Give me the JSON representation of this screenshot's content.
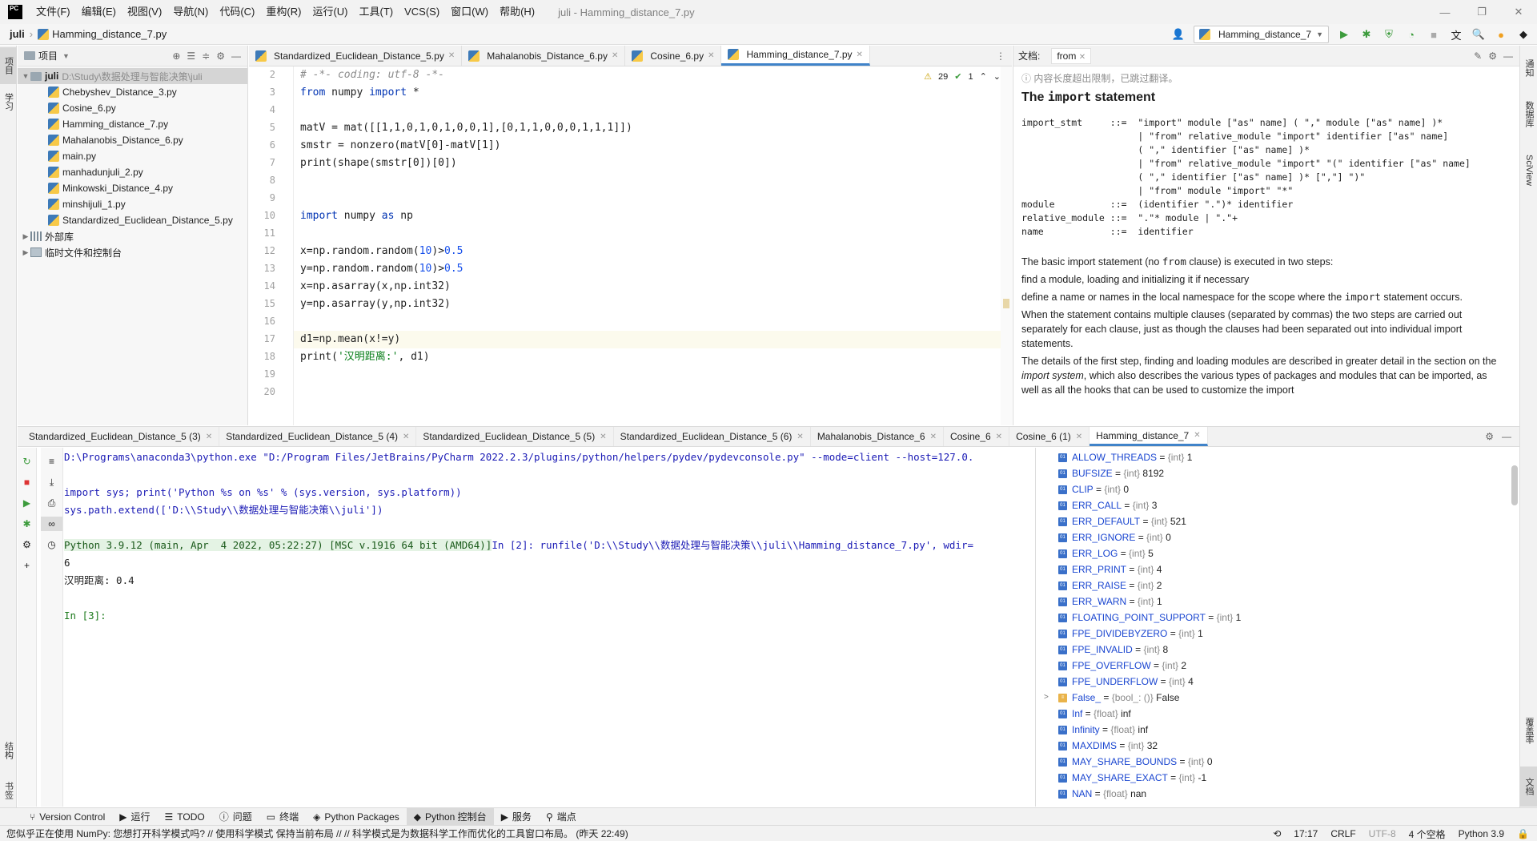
{
  "app": {
    "logo_text": "PC",
    "window_title": "juli - Hamming_distance_7.py",
    "menu": [
      "文件(F)",
      "编辑(E)",
      "视图(V)",
      "导航(N)",
      "代码(C)",
      "重构(R)",
      "运行(U)",
      "工具(T)",
      "VCS(S)",
      "窗口(W)",
      "帮助(H)"
    ]
  },
  "navbar": {
    "project": "juli",
    "file": "Hamming_distance_7.py",
    "run_config": "Hamming_distance_7"
  },
  "left_strip": {
    "project_tab": "项目",
    "learn_tab": "学习",
    "structure_tab": "结构",
    "bookmarks_tab": "书签"
  },
  "right_strip": {
    "notifications_tab": "通知",
    "database_tab": "数据库",
    "sciview_tab": "SciView",
    "coverage_tab": "覆盖率",
    "doc_tab": "文档"
  },
  "project_panel": {
    "title": "项目",
    "root_name": "juli",
    "root_path": "D:\\Study\\数据处理与智能决策\\juli",
    "files": [
      "Chebyshev_Distance_3.py",
      "Cosine_6.py",
      "Hamming_distance_7.py",
      "Mahalanobis_Distance_6.py",
      "main.py",
      "manhadunjuli_2.py",
      "Minkowski_Distance_4.py",
      "minshijuli_1.py",
      "Standardized_Euclidean_Distance_5.py"
    ],
    "external_libs": "外部库",
    "scratches": "临时文件和控制台"
  },
  "editor": {
    "tabs": [
      "Standardized_Euclidean_Distance_5.py",
      "Mahalanobis_Distance_6.py",
      "Cosine_6.py",
      "Hamming_distance_7.py"
    ],
    "active_tab": "Hamming_distance_7.py",
    "warnings": "29",
    "weak_warnings": "1",
    "line_numbers": [
      "2",
      "3",
      "4",
      "5",
      "6",
      "7",
      "8",
      "9",
      "10",
      "11",
      "12",
      "13",
      "14",
      "15",
      "16",
      "17",
      "18",
      "19",
      "20"
    ],
    "lines": {
      "l2": "# -*- coding: utf-8 -*-",
      "l3_kw1": "from",
      "l3_mid": " numpy ",
      "l3_kw2": "import",
      "l3_end": " *",
      "l5": "matV = mat([[1,1,0,1,0,1,0,0,1],[0,1,1,0,0,0,1,1,1]])",
      "l6": "smstr = nonzero(matV[0]-matV[1])",
      "l7": "print(shape(smstr[0])[0])",
      "l10_kw1": "import",
      "l10_mid": " numpy ",
      "l10_kw2": "as",
      "l10_end": " np",
      "l12_a": "x=np.random.random(",
      "l12_n": "10",
      "l12_b": ")>",
      "l12_v": "0.5",
      "l13_a": "y=np.random.random(",
      "l13_n": "10",
      "l13_b": ")>",
      "l13_v": "0.5",
      "l14": "x=np.asarray(x,np.int32)",
      "l15": "y=np.asarray(y,np.int32)",
      "l17": "d1=np.mean(x!=y)",
      "l18_a": "print(",
      "l18_s": "'汉明距离:'",
      "l18_b": ", d1)"
    }
  },
  "doc_panel": {
    "header_label": "文档:",
    "tab": "from",
    "notice": "内容长度超出限制，已跳过翻译。",
    "title_pre": "The ",
    "title_code": "import",
    "title_post": " statement",
    "grammar": "import_stmt     ::=  \"import\" module [\"as\" name] ( \",\" module [\"as\" name] )*\n                     | \"from\" relative_module \"import\" identifier [\"as\" name]\n                     ( \",\" identifier [\"as\" name] )*\n                     | \"from\" relative_module \"import\" \"(\" identifier [\"as\" name]\n                     ( \",\" identifier [\"as\" name] )* [\",\"] \")\"\n                     | \"from\" module \"import\" \"*\"\nmodule          ::=  (identifier \".\")* identifier\nrelative_module ::=  \".\"* module | \".\"+\nname            ::=  identifier",
    "p1_pre": "The basic import statement (no ",
    "p1_code": "from",
    "p1_post": " clause) is executed in two steps:",
    "p2": "find a module, loading and initializing it if necessary",
    "p3_pre": "define a name or names in the local namespace for the scope where the ",
    "p3_code": "import",
    "p3_post": " statement occurs.",
    "p4": "When the statement contains multiple clauses (separated by commas) the two steps are carried out separately for each clause, just as though the clauses had been separated out into individual import statements.",
    "p5_pre": "The details of the first step, finding and loading modules are described in greater detail in the section on the ",
    "p5_em": "import system",
    "p5_post": ", which also describes the various types of packages and modules that can be imported, as well as all the hooks that can be used to customize the import"
  },
  "console_tabs": [
    "Standardized_Euclidean_Distance_5 (3)",
    "Standardized_Euclidean_Distance_5 (4)",
    "Standardized_Euclidean_Distance_5 (5)",
    "Standardized_Euclidean_Distance_5 (6)",
    "Mahalanobis_Distance_6",
    "Cosine_6",
    "Cosine_6 (1)",
    "Hamming_distance_7"
  ],
  "console": {
    "l1": "D:\\Programs\\anaconda3\\python.exe \"D:/Program Files/JetBrains/PyCharm 2022.2.3/plugins/python/helpers/pydev/pydevconsole.py\" --mode=client --host=127.0.",
    "l2": "import sys; print('Python %s on %s' % (sys.version, sys.platform))",
    "l3": "sys.path.extend(['D:\\\\Study\\\\数据处理与智能决策\\\\juli'])",
    "l4_banner": "Python 3.9.12 (main, Apr  4 2022, 05:22:27) [MSC v.1916 64 bit (AMD64)]",
    "l4_cmd": "In [2]: runfile('D:\\\\Study\\\\数据处理与智能决策\\\\juli\\\\Hamming_distance_7.py', wdir=",
    "l5": "6",
    "l6": "汉明距离: 0.4",
    "l7": "In [3]:"
  },
  "variables": [
    {
      "name": "ALLOW_THREADS",
      "type": "{int}",
      "value": "1"
    },
    {
      "name": "BUFSIZE",
      "type": "{int}",
      "value": "8192"
    },
    {
      "name": "CLIP",
      "type": "{int}",
      "value": "0"
    },
    {
      "name": "ERR_CALL",
      "type": "{int}",
      "value": "3"
    },
    {
      "name": "ERR_DEFAULT",
      "type": "{int}",
      "value": "521"
    },
    {
      "name": "ERR_IGNORE",
      "type": "{int}",
      "value": "0"
    },
    {
      "name": "ERR_LOG",
      "type": "{int}",
      "value": "5"
    },
    {
      "name": "ERR_PRINT",
      "type": "{int}",
      "value": "4"
    },
    {
      "name": "ERR_RAISE",
      "type": "{int}",
      "value": "2"
    },
    {
      "name": "ERR_WARN",
      "type": "{int}",
      "value": "1"
    },
    {
      "name": "FLOATING_POINT_SUPPORT",
      "type": "{int}",
      "value": "1"
    },
    {
      "name": "FPE_DIVIDEBYZERO",
      "type": "{int}",
      "value": "1"
    },
    {
      "name": "FPE_INVALID",
      "type": "{int}",
      "value": "8"
    },
    {
      "name": "FPE_OVERFLOW",
      "type": "{int}",
      "value": "2"
    },
    {
      "name": "FPE_UNDERFLOW",
      "type": "{int}",
      "value": "4"
    },
    {
      "name": "False_",
      "type": "{bool_: ()}",
      "value": "False"
    },
    {
      "name": "Inf",
      "type": "{float}",
      "value": "inf"
    },
    {
      "name": "Infinity",
      "type": "{float}",
      "value": "inf"
    },
    {
      "name": "MAXDIMS",
      "type": "{int}",
      "value": "32"
    },
    {
      "name": "MAY_SHARE_BOUNDS",
      "type": "{int}",
      "value": "0"
    },
    {
      "name": "MAY_SHARE_EXACT",
      "type": "{int}",
      "value": "-1"
    },
    {
      "name": "NAN",
      "type": "{float}",
      "value": "nan"
    }
  ],
  "bottom_tabs": [
    "Version Control",
    "运行",
    "TODO",
    "问题",
    "终端",
    "Python Packages",
    "Python 控制台",
    "服务",
    "端点"
  ],
  "status": {
    "message": "您似乎正在使用 NumPy: 您想打开科学模式吗? // 使用科学模式   保持当前布局 // // 科学模式是为数据科学工作而优化的工具窗口布局。 (昨天 22:49)",
    "position": "17:17",
    "line_sep": "CRLF",
    "encoding": "UTF-8",
    "indent": "4 个空格",
    "interpreter": "Python 3.9"
  }
}
